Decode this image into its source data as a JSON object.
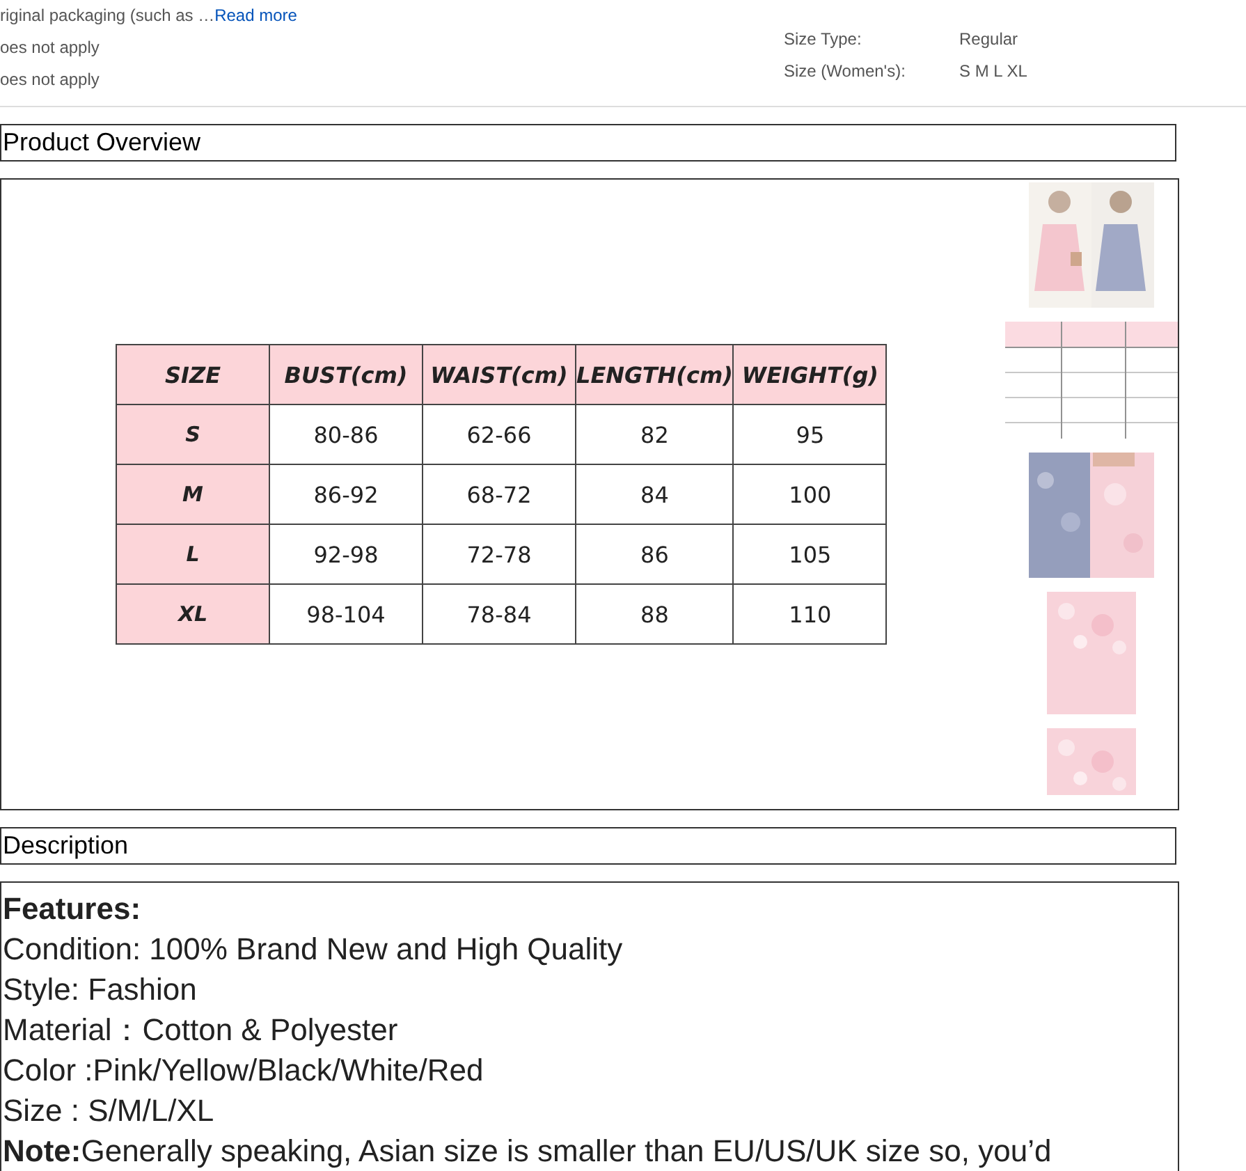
{
  "item_specifics": {
    "left": [
      {
        "text": "riginal packaging (such as …",
        "link": "Read more"
      },
      {
        "text": "oes not apply"
      },
      {
        "text": "oes not apply"
      }
    ],
    "right": [
      {
        "label": "Size Type:",
        "value": "Regular"
      },
      {
        "label": "Size (Women's):",
        "value": "S M L XL"
      }
    ]
  },
  "product_overview": {
    "title": "Product Overview",
    "size_table": {
      "columns": [
        "SIZE",
        "BUST(cm)",
        "WAIST(cm)",
        "LENGTH(cm)",
        "WEIGHT(g)"
      ],
      "rows": [
        [
          "S",
          "80-86",
          "62-66",
          "82",
          "95"
        ],
        [
          "M",
          "86-92",
          "68-72",
          "84",
          "100"
        ],
        [
          "L",
          "92-98",
          "72-78",
          "86",
          "105"
        ],
        [
          "XL",
          "98-104",
          "78-84",
          "88",
          "110"
        ]
      ]
    }
  },
  "description": {
    "title": "Description",
    "heading": "Features:",
    "lines": [
      "Condition: 100% Brand New and High Quality",
      "Style: Fashion",
      "Material：Cotton & Polyester",
      "Color :Pink/Yellow/Black/White/Red",
      "Size : S/M/L/XL",
      "**Note:**Generally speaking, Asian size is smaller than EU/US/UK size so, you’d"
    ]
  }
}
